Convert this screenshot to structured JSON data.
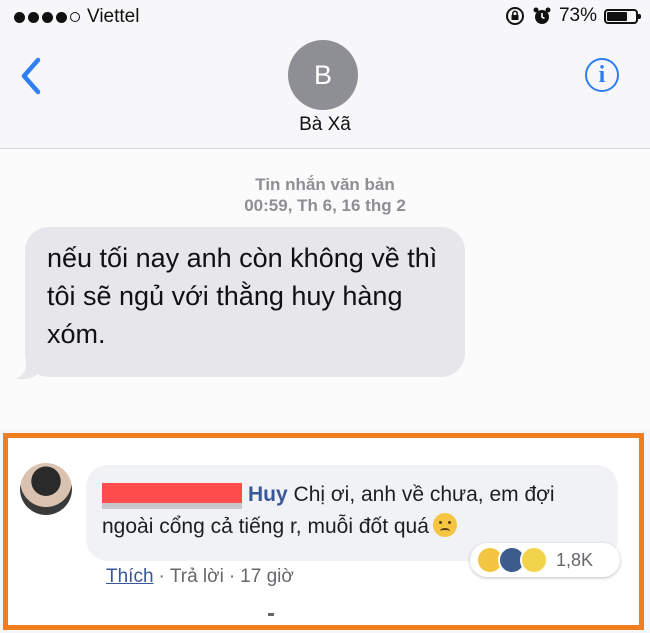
{
  "status_bar": {
    "carrier": "Viettel",
    "battery_text": "73%",
    "battery_level": 0.73,
    "signal_bars_filled": 4,
    "signal_bars_total": 5
  },
  "header": {
    "back_icon": "chevron-left-icon",
    "avatar_letter": "B",
    "contact_name": "Bà Xã",
    "info_symbol": "i"
  },
  "conversation": {
    "message_type": "Tin nhắn văn bản",
    "timestamp": "00:59, Th 6, 16 thg 2",
    "message_text": "nếu tối nay anh còn không về thì tôi sẽ ngủ với thằng huy hàng xóm."
  },
  "facebook_comment": {
    "commenter_name": "Huy",
    "comment_text": "Chị ơi, anh về chưa, em đợi ngoài cổng cả tiếng r, muỗi đốt quá",
    "reaction_count": "1,8K",
    "like_label": "Thích",
    "reply_label": "Trả lời",
    "time_ago": "17 giờ",
    "highlight_color": "#f17d1f"
  }
}
